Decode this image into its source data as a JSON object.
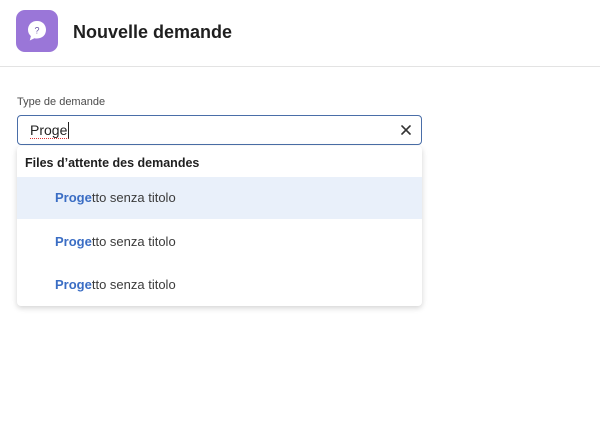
{
  "header": {
    "title": "Nouvelle demande",
    "icon": "question-chat-bubble-icon"
  },
  "form": {
    "field_label": "Type de demande",
    "input_value": "Proge"
  },
  "dropdown": {
    "group_label": "Files d’attente des demandes",
    "options": [
      {
        "match": "Proge",
        "rest": "tto senza titolo",
        "highlighted": true
      },
      {
        "match": "Proge",
        "rest": "tto senza titolo",
        "highlighted": false
      },
      {
        "match": "Proge",
        "rest": "tto senza titolo",
        "highlighted": false
      }
    ]
  },
  "colors": {
    "accent": "#9a76d8",
    "match_text": "#3a6dc4",
    "input_border": "#4a6ea8",
    "highlight_bg": "#e9f0fa"
  }
}
